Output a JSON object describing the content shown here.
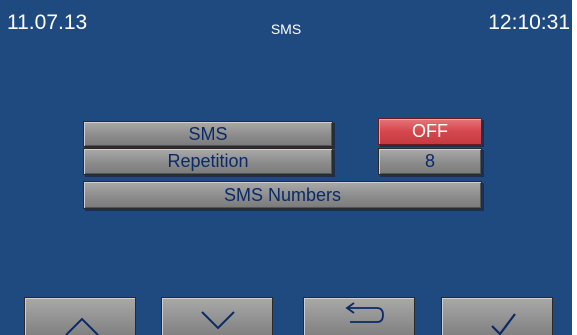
{
  "status_bar": {
    "date": "11.07.13",
    "title": "SMS",
    "time": "12:10:31"
  },
  "menu": {
    "sms_label": "SMS",
    "sms_value": "OFF",
    "repetition_label": "Repetition",
    "repetition_value": "8",
    "sms_numbers_label": "SMS Numbers"
  },
  "nav": {
    "up_icon": "chevron-up-icon",
    "down_icon": "chevron-down-icon",
    "back_icon": "return-arrow-icon",
    "ok_icon": "checkmark-icon"
  },
  "colors": {
    "screen_background": "#1f4a80",
    "button_gray": "#8c8c8c",
    "button_text": "#0a2a66",
    "off_red": "#d6474d",
    "status_text": "#ffffff"
  }
}
